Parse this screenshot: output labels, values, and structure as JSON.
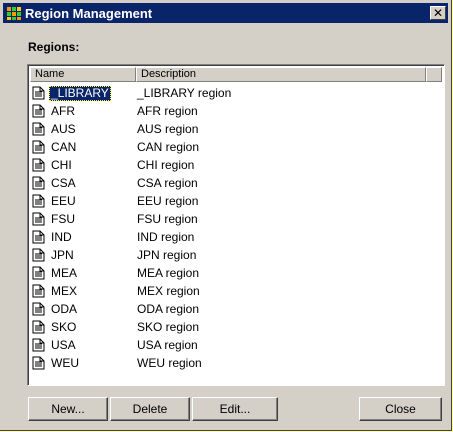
{
  "window": {
    "title": "Region Management",
    "close_glyph": "✕"
  },
  "regions_label": "Regions:",
  "columns": [
    "Name",
    "Description",
    ""
  ],
  "rows": [
    {
      "name": "_LIBRARY",
      "description": "_LIBRARY region",
      "selected": true
    },
    {
      "name": "AFR",
      "description": "AFR region"
    },
    {
      "name": "AUS",
      "description": "AUS region"
    },
    {
      "name": "CAN",
      "description": "CAN region"
    },
    {
      "name": "CHI",
      "description": "CHI region"
    },
    {
      "name": "CSA",
      "description": "CSA region"
    },
    {
      "name": "EEU",
      "description": "EEU region"
    },
    {
      "name": "FSU",
      "description": "FSU region"
    },
    {
      "name": "IND",
      "description": "IND region"
    },
    {
      "name": "JPN",
      "description": "JPN region"
    },
    {
      "name": "MEA",
      "description": "MEA region"
    },
    {
      "name": "MEX",
      "description": "MEX region"
    },
    {
      "name": "ODA",
      "description": "ODA region"
    },
    {
      "name": "SKO",
      "description": "SKO region"
    },
    {
      "name": "USA",
      "description": "USA region"
    },
    {
      "name": "WEU",
      "description": "WEU region"
    }
  ],
  "buttons": {
    "new": "New...",
    "delete": "Delete",
    "edit": "Edit...",
    "close": "Close"
  },
  "colors": {
    "selection": "#0a246a",
    "page_background": "#ffff99",
    "dialog_face": "#d4d0c8"
  },
  "icons": {
    "app": "app-grid-icon",
    "row": "document-icon"
  }
}
